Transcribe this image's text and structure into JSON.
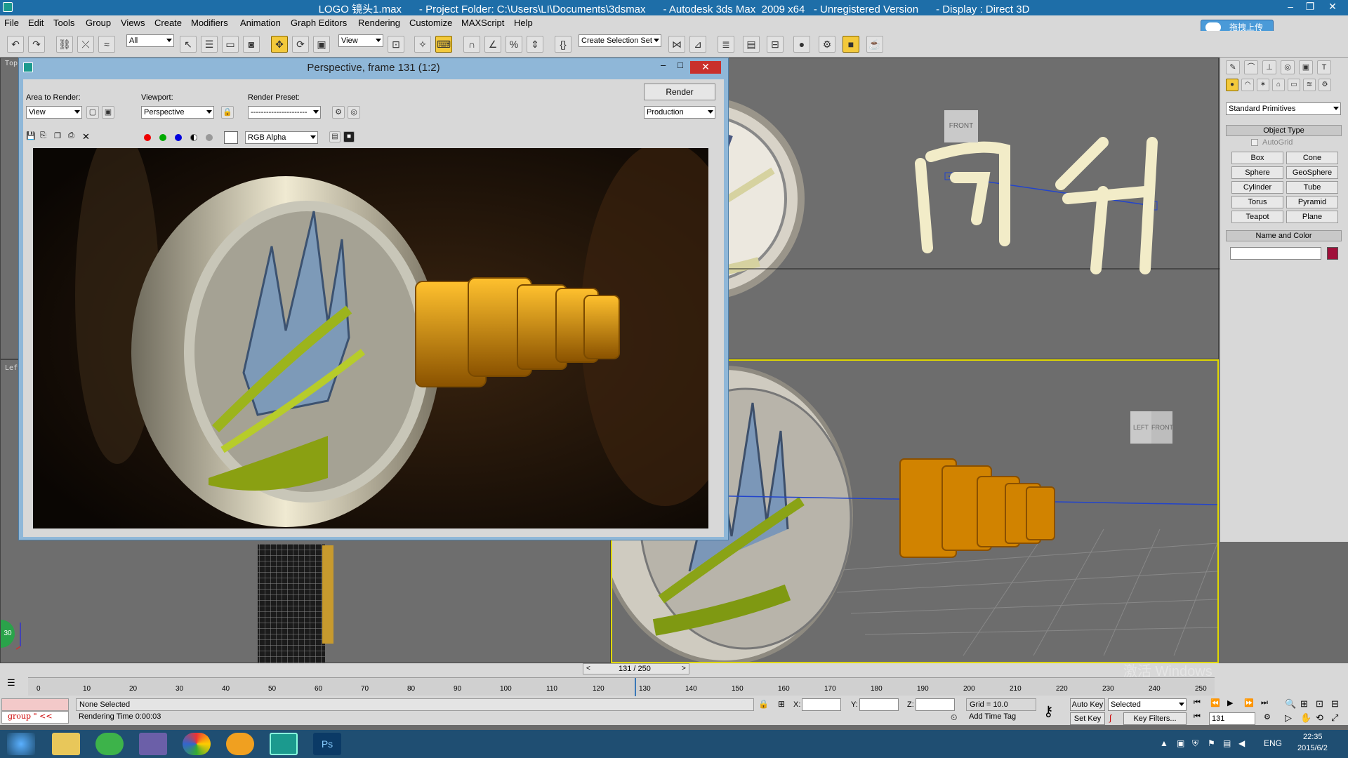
{
  "window": {
    "title": "LOGO 镜头1.max      - Project Folder: C:\\Users\\LI\\Documents\\3dsmax      - Autodesk 3ds Max  2009 x64   - Unregistered Version      - Display : Direct 3D"
  },
  "menu": [
    "File",
    "Edit",
    "Tools",
    "Group",
    "Views",
    "Create",
    "Modifiers",
    "Animation",
    "Graph Editors",
    "Rendering",
    "Customize",
    "MAXScript",
    "Help"
  ],
  "cloud_upload": "拖拽上传",
  "toolbar": {
    "selection_filter": "All",
    "ref_coord": "View",
    "named_selection": "Create Selection Set"
  },
  "viewports": {
    "top_label": "Top",
    "left_label": "Left",
    "front_cube": "FRONT",
    "persp_cube_left": "LEFT",
    "persp_cube_front": "FRONT",
    "badge_30": "30"
  },
  "render_dialog": {
    "title": "Perspective, frame 131 (1:2)",
    "area_to_render_label": "Area to Render:",
    "area_to_render_value": "View",
    "viewport_label": "Viewport:",
    "viewport_value": "Perspective",
    "render_preset_label": "Render Preset:",
    "render_preset_value": "----------------------",
    "render_button": "Render",
    "production_value": "Production",
    "channel_value": "RGB Alpha"
  },
  "command_panel": {
    "category": "Standard Primitives",
    "object_type_header": "Object Type",
    "autogrid": "AutoGrid",
    "primitives": [
      "Box",
      "Cone",
      "Sphere",
      "GeoSphere",
      "Cylinder",
      "Tube",
      "Torus",
      "Pyramid",
      "Teapot",
      "Plane"
    ],
    "name_color_header": "Name and Color",
    "swatch_color": "#a0103a"
  },
  "timeline": {
    "frame_display": "131 / 250",
    "ticks": [
      "0",
      "10",
      "20",
      "30",
      "40",
      "50",
      "60",
      "70",
      "80",
      "90",
      "100",
      "110",
      "120",
      "130",
      "140",
      "150",
      "160",
      "170",
      "180",
      "190",
      "200",
      "210",
      "220",
      "230",
      "240",
      "250"
    ]
  },
  "status": {
    "maxscript_listener": "group \" <<",
    "selection": "None Selected",
    "prompt": "Rendering Time 0:00:03",
    "x_label": "X:",
    "y_label": "Y:",
    "z_label": "Z:",
    "grid": "Grid = 10.0",
    "add_time_tag": "Add Time Tag",
    "auto_key": "Auto Key",
    "set_key": "Set Key",
    "key_mode": "Selected",
    "key_filters": "Key Filters...",
    "current_frame": "131"
  },
  "watermark": "激活 Windows",
  "taskbar": {
    "lang": "ENG",
    "time": "22:35",
    "date": "2015/6/2"
  }
}
